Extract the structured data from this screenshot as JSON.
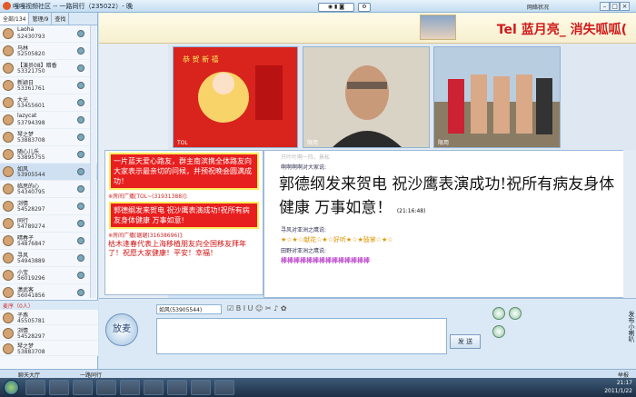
{
  "window": {
    "title": "嘎嘎视频社区 -- 一路同行（235022）- 晚",
    "net_status": "网络状况"
  },
  "sidebar": {
    "tabs": [
      {
        "label": "全部/134"
      },
      {
        "label": "管理/9"
      },
      {
        "label": "查找"
      }
    ],
    "users": [
      {
        "name": "Laoha",
        "id": "52430793"
      },
      {
        "name": "马林",
        "id": "52505820"
      },
      {
        "name": "【演员08】暗香",
        "id": "53321750"
      },
      {
        "name": "新颖日",
        "id": "53361761"
      },
      {
        "name": "大光",
        "id": "53455601"
      },
      {
        "name": "lazycat",
        "id": "53794398"
      },
      {
        "name": "琴之梦",
        "id": "53883708"
      },
      {
        "name": "随心儿乐",
        "id": "53895755"
      },
      {
        "name": "如风",
        "id": "53905544"
      },
      {
        "name": "临思的心",
        "id": "54340795"
      },
      {
        "name": "浏情",
        "id": "54528297"
      },
      {
        "name": "同行",
        "id": "54789274"
      },
      {
        "name": "晴春子",
        "id": "54876847"
      },
      {
        "name": "寻风",
        "id": "54943889"
      },
      {
        "name": "小宝",
        "id": "56019296"
      },
      {
        "name": "潇武客",
        "id": "56041856"
      }
    ],
    "mic_header": "麦序（0人）",
    "mic_users": [
      {
        "name": "子燕",
        "id": "45505781"
      },
      {
        "name": "浏情",
        "id": "54528297"
      },
      {
        "name": "琴之梦",
        "id": "53883708"
      }
    ]
  },
  "banner": {
    "text": "Tel 蓝月亮_ 消失呱呱("
  },
  "videos": [
    {
      "label": "TOL"
    },
    {
      "label": "限用"
    },
    {
      "label": "限用"
    }
  ],
  "public_chat": {
    "lines": [
      {
        "kind": "redbox",
        "text": "一片蓝天爱心路友，群主南滨携全体路友向大家表示最亲切的问候，并预祝晚会圆满成功！"
      },
      {
        "kind": "sys",
        "text": "※房间广播[TOL~(31931388)]:"
      },
      {
        "kind": "redbox",
        "text": "郭德纲发来贺电 祝沙鹰表演成功!祝所有病友身体健康 万事如意!"
      },
      {
        "kind": "sys",
        "text": "※房间广播[琚琚(31638696)]:"
      },
      {
        "kind": "redline",
        "text": "枯木逢春代表上海移植朋友向全国移友拜年了！祝愿大家健康！平安！幸福！"
      }
    ]
  },
  "private_chat": {
    "faint": "只叶叶啊一阵，景松",
    "sender": "啊啊啊啊对大家说:",
    "message": "郭德纲发来贺电 祝沙鹰表演成功!祝所有病友身体健康 万事如意！",
    "time": "(21:16:48)",
    "line2_who": "寻风对亚洲之鹰说:",
    "line2_text": "★☆★☆献花☆★☆好听★☆★鼓掌☆★☆",
    "line3_who": "田野对亚洲之鹰说:",
    "line3_text": "棒棒棒棒棒棒棒棒棒棒棒棒棒棒"
  },
  "composer": {
    "mic_label": "放麦",
    "user_select": "如风(53905544)",
    "send_label": "发 送",
    "broadcast_label": "发布小喇叭"
  },
  "statusbar": {
    "left": "聊天大厅",
    "room": "一路同行",
    "right": "举报"
  },
  "taskbar": {
    "time": "21:17",
    "date": "2011/1/22"
  }
}
